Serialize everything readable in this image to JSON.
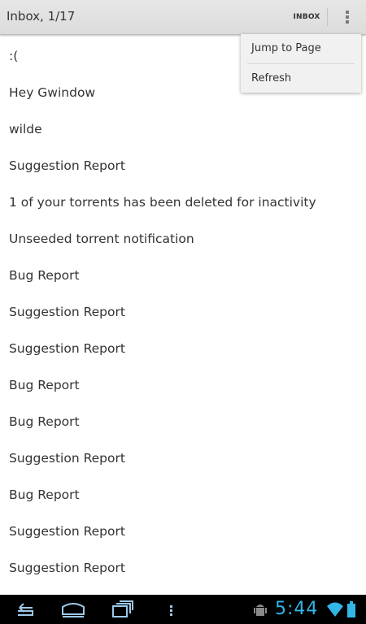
{
  "action_bar": {
    "title": "Inbox, 1/17",
    "inbox_action_label": "INBOX",
    "overflow_icon": "overflow-menu-icon"
  },
  "messages": [
    ":(",
    "Hey Gwindow",
    "wilde",
    "Suggestion Report",
    "1 of your torrents has been deleted for inactivity",
    "Unseeded torrent notification",
    "Bug Report",
    "Suggestion Report",
    "Suggestion Report",
    "Bug Report",
    "Bug Report",
    "Suggestion Report",
    "Bug Report",
    "Suggestion Report",
    "Suggestion Report"
  ],
  "popup_menu": {
    "items": [
      "Jump to Page",
      "Refresh"
    ]
  },
  "nav_bar": {
    "icons": [
      "back-icon",
      "home-icon",
      "recent-apps-icon",
      "menu-icon"
    ]
  },
  "status": {
    "time": "5:44",
    "icons": [
      "android-debug-icon",
      "wifi-icon",
      "battery-icon"
    ],
    "accent_color": "#33b5e5"
  }
}
